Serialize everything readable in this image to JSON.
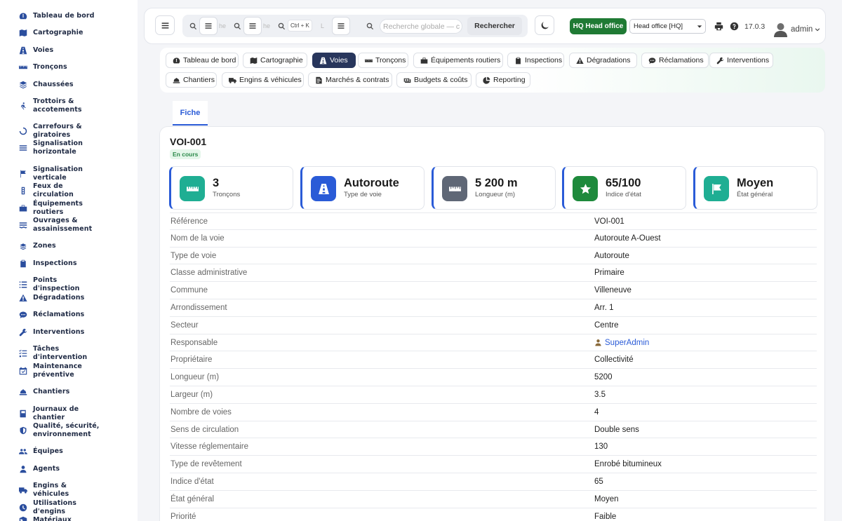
{
  "sidebar": {
    "items": [
      {
        "label": "Tableau de bord",
        "icon": "dashboard-icon"
      },
      {
        "label": "Cartographie",
        "icon": "map-icon"
      },
      {
        "label": "Voies",
        "icon": "road-icon"
      },
      {
        "label": "Tronçons",
        "icon": "ruler-icon"
      },
      {
        "label": "Chaussées",
        "icon": "layers-icon"
      },
      {
        "label": "Trottoirs & accotements",
        "icon": "walk-icon"
      },
      {
        "label": "Carrefours & giratoires",
        "icon": "roundabout-icon"
      },
      {
        "label": "Signalisation horizontale",
        "icon": "stripes-icon"
      },
      {
        "label": "Signalisation verticale",
        "icon": "sign-icon"
      },
      {
        "label": "Feux de circulation",
        "icon": "traffic-light-icon"
      },
      {
        "label": "Équipements routiers",
        "icon": "barrier-icon"
      },
      {
        "label": "Ouvrages & assainissement",
        "icon": "water-icon"
      },
      {
        "label": "Zones",
        "icon": "zones-icon"
      },
      {
        "label": "Inspections",
        "icon": "clipboard-icon"
      },
      {
        "label": "Points d'inspection",
        "icon": "list-icon"
      },
      {
        "label": "Dégradations",
        "icon": "warning-icon"
      },
      {
        "label": "Réclamations",
        "icon": "chat-icon"
      },
      {
        "label": "Interventions",
        "icon": "wrench-icon"
      },
      {
        "label": "Tâches d'intervention",
        "icon": "tasks-icon"
      },
      {
        "label": "Maintenance préventive",
        "icon": "calendar-check-icon"
      },
      {
        "label": "Chantiers",
        "icon": "hard-hat-icon"
      },
      {
        "label": "Journaux de chantier",
        "icon": "book-icon"
      },
      {
        "label": "Qualité, sécurité, environnement",
        "icon": "shield-icon"
      },
      {
        "label": "Équipes",
        "icon": "users-icon"
      },
      {
        "label": "Agents",
        "icon": "user-icon"
      },
      {
        "label": "Engins & véhicules",
        "icon": "truck-icon"
      },
      {
        "label": "Utilisations d'engins",
        "icon": "clock-icon"
      },
      {
        "label": "Matériaux",
        "icon": "box-icon"
      }
    ]
  },
  "topbar": {
    "search_fragments": [
      "he",
      "he",
      "L"
    ],
    "kbd_hint": "Ctrl + K",
    "global_search_placeholder": "Recherche globale — c",
    "search_button": "Rechercher",
    "company_badge": "HQ Head office",
    "company_select": "Head office [HQ]",
    "version": "17.0.3",
    "user": "admin"
  },
  "nav": {
    "row1": [
      {
        "label": "Tableau de bord",
        "icon": "dashboard-icon",
        "active": false
      },
      {
        "label": "Cartographie",
        "icon": "map-icon",
        "active": false
      },
      {
        "label": "Voies",
        "icon": "road-icon",
        "active": true
      },
      {
        "label": "Tronçons",
        "icon": "ruler-icon",
        "active": false
      },
      {
        "label": "Équipements routiers",
        "icon": "barrier-icon",
        "active": false
      },
      {
        "label": "Inspections",
        "icon": "clipboard-icon",
        "active": false
      },
      {
        "label": "Dégradations",
        "icon": "warning-icon",
        "active": false
      },
      {
        "label": "Réclamations",
        "icon": "chat-icon",
        "active": false
      },
      {
        "label": "Interventions",
        "icon": "wrench-icon",
        "active": false
      }
    ],
    "row2": [
      {
        "label": "Chantiers",
        "icon": "hard-hat-icon",
        "active": false
      },
      {
        "label": "Engins & véhicules",
        "icon": "truck-icon",
        "active": false
      },
      {
        "label": "Marchés & contrats",
        "icon": "contract-icon",
        "active": false
      },
      {
        "label": "Budgets & coûts",
        "icon": "money-icon",
        "active": false
      },
      {
        "label": "Reporting",
        "icon": "pie-icon",
        "active": false
      }
    ]
  },
  "tabs": {
    "fiche": "Fiche"
  },
  "record": {
    "title": "VOI-001",
    "status": "En cours",
    "kpis": [
      {
        "value": "3",
        "label": "Tronçons",
        "icon": "ruler-icon",
        "color": "#1fae93"
      },
      {
        "value": "Autoroute",
        "label": "Type de voie",
        "icon": "road-icon",
        "color": "#2a5bd7"
      },
      {
        "value": "5 200 m",
        "label": "Longueur (m)",
        "icon": "ruler-icon",
        "color": "#5f6776"
      },
      {
        "value": "65/100",
        "label": "Indice d'état",
        "icon": "star-icon",
        "color": "#1e8a3c"
      },
      {
        "value": "Moyen",
        "label": "État général",
        "icon": "flag-icon",
        "color": "#1fae93"
      }
    ],
    "fields": [
      {
        "key": "Référence",
        "value": "VOI-001"
      },
      {
        "key": "Nom de la voie",
        "value": "Autoroute A-Ouest"
      },
      {
        "key": "Type de voie",
        "value": "Autoroute"
      },
      {
        "key": "Classe administrative",
        "value": "Primaire"
      },
      {
        "key": "Commune",
        "value": "Villeneuve"
      },
      {
        "key": "Arrondissement",
        "value": "Arr. 1"
      },
      {
        "key": "Secteur",
        "value": "Centre"
      },
      {
        "key": "Responsable",
        "value": "SuperAdmin",
        "link": true
      },
      {
        "key": "Propriétaire",
        "value": "Collectivité"
      },
      {
        "key": "Longueur (m)",
        "value": "5200"
      },
      {
        "key": "Largeur (m)",
        "value": "3.5"
      },
      {
        "key": "Nombre de voies",
        "value": "4"
      },
      {
        "key": "Sens de circulation",
        "value": "Double sens"
      },
      {
        "key": "Vitesse réglementaire",
        "value": "130"
      },
      {
        "key": "Type de revêtement",
        "value": "Enrobé bitumineux"
      },
      {
        "key": "Indice d'état",
        "value": "65"
      },
      {
        "key": "État général",
        "value": "Moyen"
      },
      {
        "key": "Priorité",
        "value": "Faible"
      }
    ]
  }
}
